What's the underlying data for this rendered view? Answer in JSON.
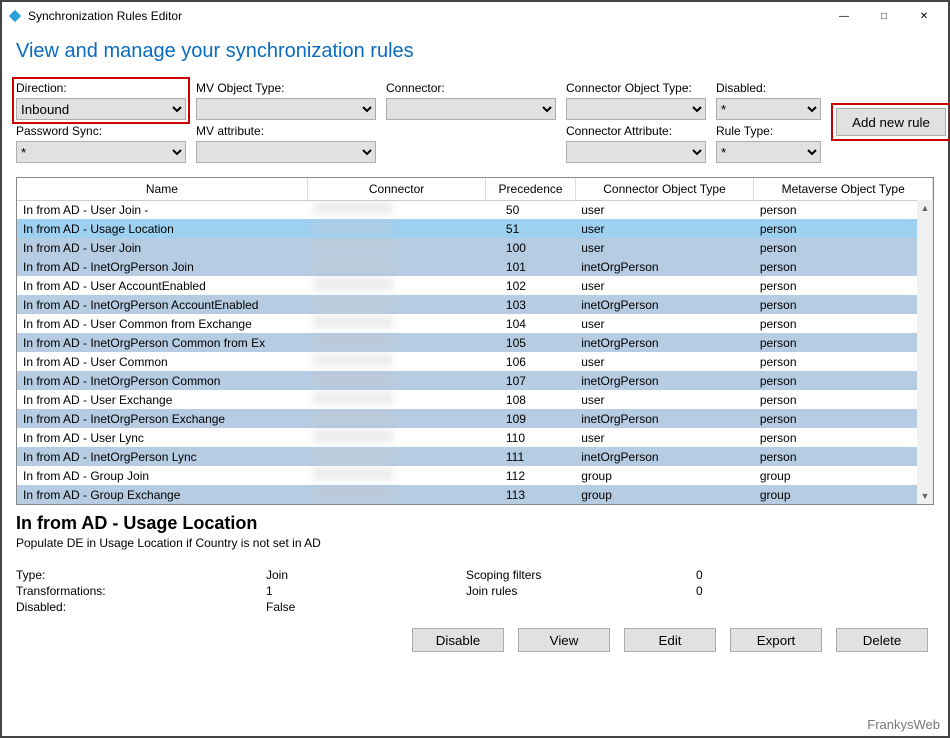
{
  "window": {
    "title": "Synchronization Rules Editor"
  },
  "page": {
    "heading": "View and manage your synchronization rules"
  },
  "filters": {
    "direction": {
      "label": "Direction:",
      "value": "Inbound"
    },
    "mvObject": {
      "label": "MV Object Type:",
      "value": ""
    },
    "connector": {
      "label": "Connector:",
      "value": ""
    },
    "connObject": {
      "label": "Connector Object Type:",
      "value": ""
    },
    "disabled": {
      "label": "Disabled:",
      "value": "*"
    },
    "pwdSync": {
      "label": "Password Sync:",
      "value": "*"
    },
    "mvAttr": {
      "label": "MV attribute:",
      "value": ""
    },
    "connAttr": {
      "label": "Connector Attribute:",
      "value": ""
    },
    "ruleType": {
      "label": "Rule Type:",
      "value": "*"
    }
  },
  "addBtn": "Add new rule",
  "columns": {
    "name": "Name",
    "connector": "Connector",
    "precedence": "Precedence",
    "cot": "Connector Object Type",
    "mot": "Metaverse Object Type"
  },
  "rows": [
    {
      "name": "In from AD - User Join -",
      "prec": "50",
      "cot": "user",
      "mot": "person",
      "cls": ""
    },
    {
      "name": "In from AD - Usage Location",
      "prec": "51",
      "cot": "user",
      "mot": "person",
      "cls": "row-sel"
    },
    {
      "name": "In from AD - User Join",
      "prec": "100",
      "cot": "user",
      "mot": "person",
      "cls": "row-alt"
    },
    {
      "name": "In from AD - InetOrgPerson Join",
      "prec": "101",
      "cot": "inetOrgPerson",
      "mot": "person",
      "cls": "row-alt"
    },
    {
      "name": "In from AD - User AccountEnabled",
      "prec": "102",
      "cot": "user",
      "mot": "person",
      "cls": ""
    },
    {
      "name": "In from AD - InetOrgPerson AccountEnabled",
      "prec": "103",
      "cot": "inetOrgPerson",
      "mot": "person",
      "cls": "row-alt"
    },
    {
      "name": "In from AD - User Common from Exchange",
      "prec": "104",
      "cot": "user",
      "mot": "person",
      "cls": ""
    },
    {
      "name": "In from AD - InetOrgPerson Common from Ex",
      "prec": "105",
      "cot": "inetOrgPerson",
      "mot": "person",
      "cls": "row-alt"
    },
    {
      "name": "In from AD - User Common",
      "prec": "106",
      "cot": "user",
      "mot": "person",
      "cls": ""
    },
    {
      "name": "In from AD - InetOrgPerson Common",
      "prec": "107",
      "cot": "inetOrgPerson",
      "mot": "person",
      "cls": "row-alt"
    },
    {
      "name": "In from AD - User Exchange",
      "prec": "108",
      "cot": "user",
      "mot": "person",
      "cls": ""
    },
    {
      "name": "In from AD - InetOrgPerson Exchange",
      "prec": "109",
      "cot": "inetOrgPerson",
      "mot": "person",
      "cls": "row-alt"
    },
    {
      "name": "In from AD - User Lync",
      "prec": "110",
      "cot": "user",
      "mot": "person",
      "cls": ""
    },
    {
      "name": "In from AD - InetOrgPerson Lync",
      "prec": "111",
      "cot": "inetOrgPerson",
      "mot": "person",
      "cls": "row-alt"
    },
    {
      "name": "In from AD - Group Join",
      "prec": "112",
      "cot": "group",
      "mot": "group",
      "cls": ""
    },
    {
      "name": "In from AD - Group Exchange",
      "prec": "113",
      "cot": "group",
      "mot": "group",
      "cls": "row-alt"
    }
  ],
  "details": {
    "title": "In from AD - Usage Location",
    "desc": "Populate DE in Usage Location if Country is not set in AD",
    "typeLabel": "Type:",
    "typeVal": "Join",
    "transLabel": "Transformations:",
    "transVal": "1",
    "disLabel": "Disabled:",
    "disVal": "False",
    "scopLabel": "Scoping filters",
    "scopVal": "0",
    "joinLabel": "Join rules",
    "joinVal": "0"
  },
  "actions": {
    "disable": "Disable",
    "view": "View",
    "edit": "Edit",
    "export": "Export",
    "delete": "Delete"
  },
  "watermark": "FrankysWeb"
}
